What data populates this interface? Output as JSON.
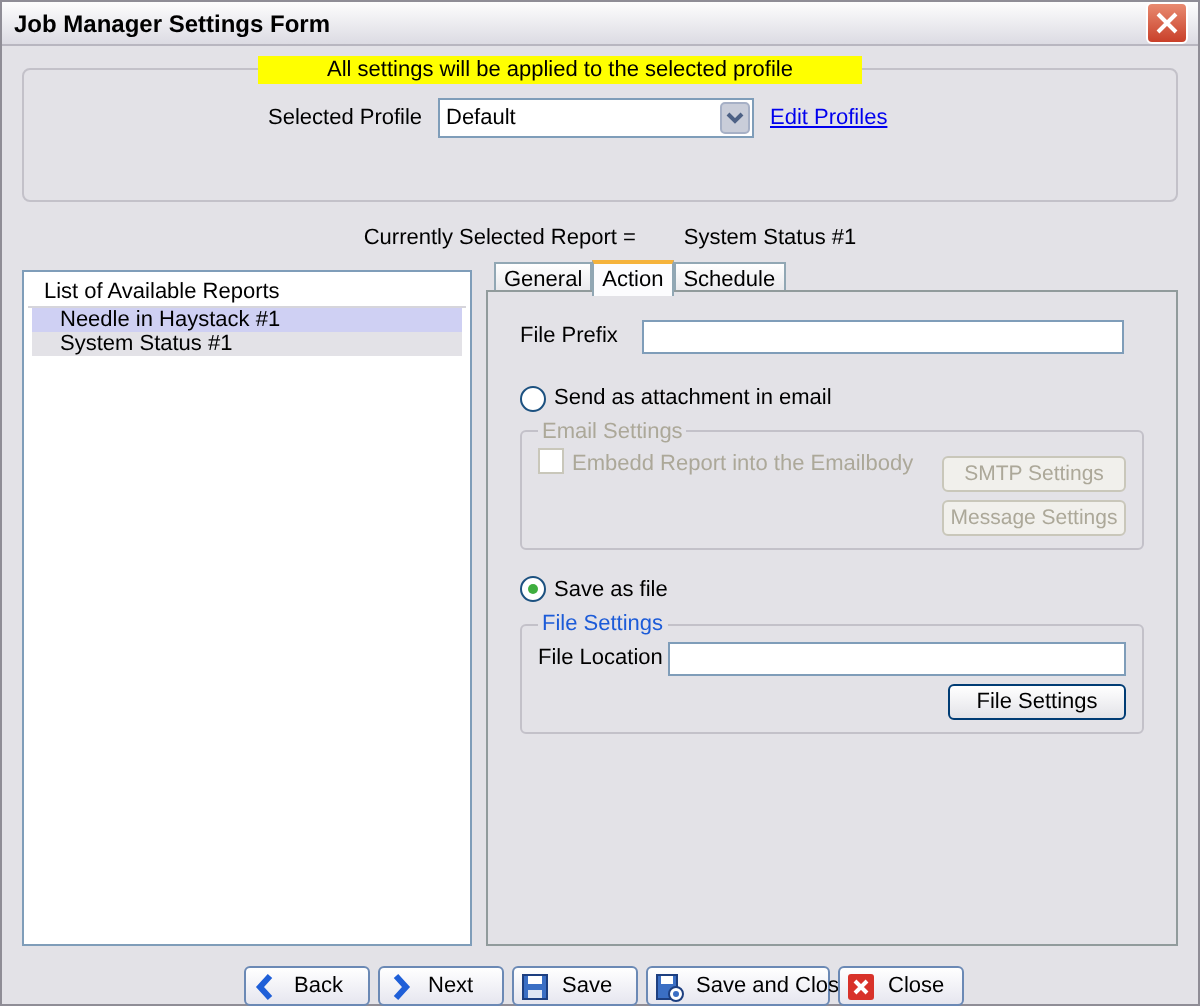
{
  "window": {
    "title": "Job Manager Settings Form"
  },
  "banner": "All settings will be applied to the selected profile",
  "profile": {
    "label": "Selected Profile",
    "value": "Default",
    "link": "Edit Profiles"
  },
  "current_report": {
    "label": "Currently Selected Report =",
    "value": "System Status #1"
  },
  "reports": {
    "header": "List of Available Reports",
    "items": [
      {
        "label": "Needle in Haystack #1",
        "selected": true
      },
      {
        "label": "System Status #1",
        "selected": false
      }
    ]
  },
  "tabs": [
    {
      "label": "General",
      "selected": false
    },
    {
      "label": "Action",
      "selected": true
    },
    {
      "label": "Schedule",
      "selected": false
    }
  ],
  "action": {
    "file_prefix_label": "File Prefix",
    "email_option": {
      "label": "Send as attachment in email",
      "selected": false
    },
    "email_settings": {
      "title": "Email Settings",
      "disabled": true,
      "embed": {
        "label": "Embedd Report into the Emailbody",
        "checked": false
      },
      "buttons": [
        "SMTP Settings",
        "Message Settings"
      ]
    },
    "file_option": {
      "label": "Save as file",
      "selected": true
    },
    "file_settings": {
      "title": "File Settings",
      "location_label": "File Location",
      "button": "File Settings"
    }
  },
  "buttons": [
    {
      "label": "Back",
      "kind": "back"
    },
    {
      "label": "Next",
      "kind": "next"
    },
    {
      "label": "Save",
      "kind": "save"
    },
    {
      "label": "Save and Clos",
      "kind": "savec"
    },
    {
      "label": "Close",
      "kind": "close"
    }
  ]
}
